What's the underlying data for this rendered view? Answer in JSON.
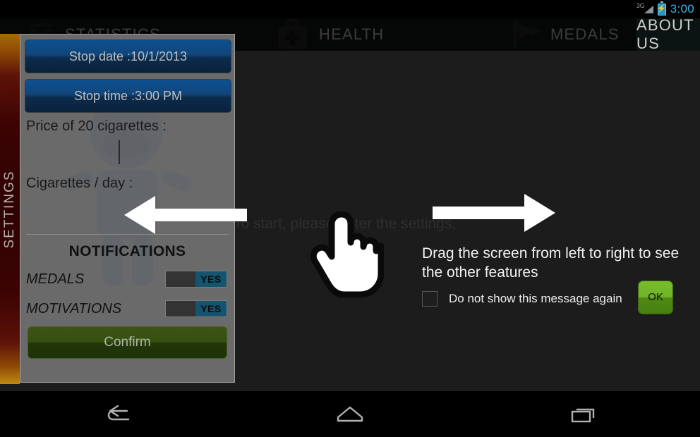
{
  "statusbar": {
    "network_label": "3G",
    "network_icon": "signal-3g-icon",
    "battery_icon": "battery-charging-icon",
    "clock": "3:00",
    "clock_color": "#35b5e5"
  },
  "topnav": {
    "items": [
      {
        "label": "STATISTICS",
        "icon": "bar-chart-icon"
      },
      {
        "label": "HEALTH",
        "icon": "medical-briefcase-icon"
      },
      {
        "label": "MEDALS",
        "icon": "flag-icon"
      },
      {
        "label": "ABOUT US",
        "icon": "none"
      }
    ]
  },
  "content": {
    "start_hint": "To start, please enter the settings."
  },
  "settings_tab": {
    "label": "SETTINGS",
    "gradient_top": "#a86a07",
    "gradient_mid": "#2e0202",
    "gradient_bottom": "#c08a12"
  },
  "settings_panel": {
    "stop_date_button": "Stop date :10/1/2013",
    "stop_time_button": "Stop time :3:00 PM",
    "price_label": "Price of 20 cigarettes :",
    "price_value": "",
    "price_placeholder": "",
    "cigs_per_day_label": "Cigarettes / day :",
    "cigs_per_day_value": "",
    "cigs_per_day_placeholder": "",
    "notifications_title": "NOTIFICATIONS",
    "toggles": [
      {
        "label": "MEDALS",
        "state": "YES"
      },
      {
        "label": "MOTIVATIONS",
        "state": "YES"
      }
    ],
    "confirm_button": "Confirm",
    "button_color": "#0c5190",
    "confirm_color": "#35500f"
  },
  "tutorial": {
    "message": "Drag the screen from left to right to see the other features",
    "dont_show_label": "Do not show this message again",
    "ok_button": "OK",
    "ok_color": "#6fb328",
    "arrow_left_icon": "arrow-left-icon",
    "arrow_right_icon": "arrow-right-icon",
    "hand_icon": "pointing-hand-icon"
  },
  "navbar": {
    "back": "back-icon",
    "home": "home-icon",
    "recents": "recent-apps-icon"
  }
}
